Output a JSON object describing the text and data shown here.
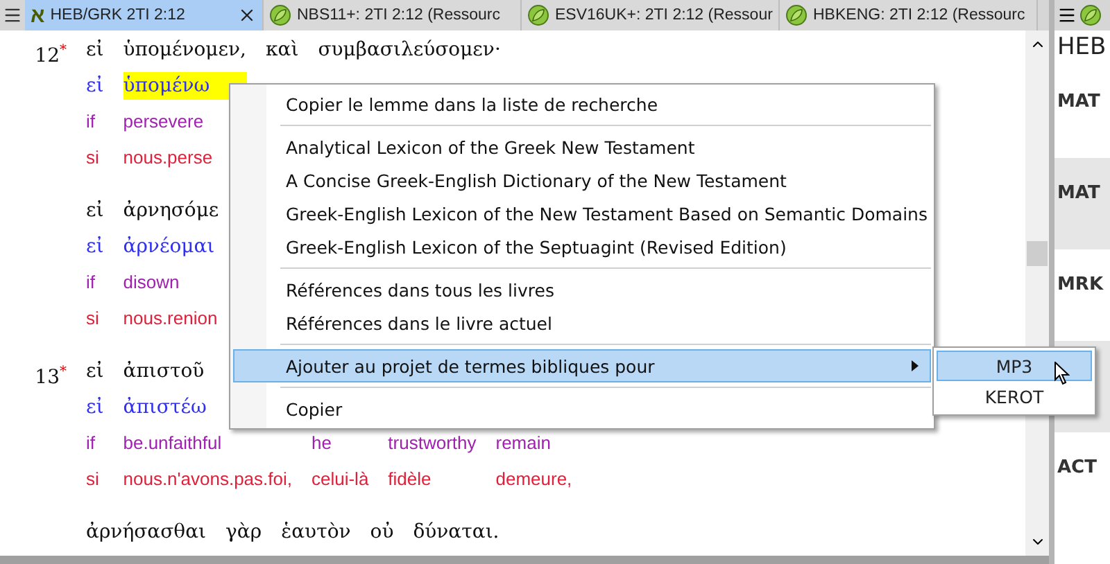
{
  "tabs": [
    {
      "label": "HEB/GRK 2TI 2:12",
      "glyph": "א",
      "selected": true
    },
    {
      "label": "NBS11+: 2TI 2:12 (Ressourc",
      "selected": false
    },
    {
      "label": "ESV16UK+: 2TI 2:12 (Ressour",
      "selected": false
    },
    {
      "label": "HBKENG: 2TI 2:12 (Ressourc",
      "selected": false
    }
  ],
  "text_blocks": [
    {
      "verse": {
        "number": "12",
        "mark": "*"
      },
      "lines": [
        {
          "kind": "greek",
          "words": [
            {
              "text": "εἰ"
            },
            {
              "text": "ὑπομένομεν,"
            },
            {
              "text": "καὶ"
            },
            {
              "text": "συμβασιλεύσομεν·"
            }
          ]
        },
        {
          "kind": "lemma",
          "words": [
            {
              "text": "εἰ",
              "highlighted": false
            },
            {
              "text": "ὑπομένω",
              "highlighted": true
            }
          ]
        },
        {
          "kind": "gloss_en",
          "words": [
            {
              "text": "if"
            },
            {
              "text": "persevere"
            }
          ]
        },
        {
          "kind": "gloss_fr",
          "words": [
            {
              "text": "si"
            },
            {
              "text": "nous.perse"
            }
          ]
        }
      ]
    },
    {
      "lines": [
        {
          "kind": "greek",
          "words": [
            {
              "text": "εἰ"
            },
            {
              "text": "ἀρνησόμε"
            }
          ]
        },
        {
          "kind": "lemma",
          "words": [
            {
              "text": "εἰ"
            },
            {
              "text": "ἀρνέομαι"
            }
          ]
        },
        {
          "kind": "gloss_en",
          "words": [
            {
              "text": "if"
            },
            {
              "text": "disown"
            }
          ]
        },
        {
          "kind": "gloss_fr",
          "words": [
            {
              "text": "si"
            },
            {
              "text": "nous.renion"
            }
          ]
        }
      ]
    },
    {
      "verse": {
        "number": "13",
        "mark": "*"
      },
      "lines": [
        {
          "kind": "greek",
          "words": [
            {
              "text": "εἰ"
            },
            {
              "text": "ἀπιστοῦ"
            }
          ]
        },
        {
          "kind": "lemma",
          "words": [
            {
              "text": "εἰ"
            },
            {
              "text": "ἀπιστέω"
            }
          ]
        },
        {
          "kind": "gloss_en",
          "words": [
            {
              "text": "if"
            },
            {
              "text": "be.unfaithful"
            },
            {
              "text": "he"
            },
            {
              "text": "trustworthy"
            },
            {
              "text": "remain"
            }
          ]
        },
        {
          "kind": "gloss_fr",
          "words": [
            {
              "text": "si"
            },
            {
              "text": "nous.n'avons.pas.foi,"
            },
            {
              "text": "celui-là"
            },
            {
              "text": "fidèle"
            },
            {
              "text": "demeure,"
            }
          ]
        }
      ]
    },
    {
      "lines": [
        {
          "kind": "greek",
          "words": [
            {
              "text": "ἀρνήσασθαι"
            },
            {
              "text": "γὰρ"
            },
            {
              "text": "ἑαυτὸν"
            },
            {
              "text": "οὐ"
            },
            {
              "text": "δύναται."
            }
          ]
        }
      ]
    }
  ],
  "context_menu": [
    {
      "kind": "item",
      "label": "Copier le lemme dans la liste de recherche",
      "highlighted": false
    },
    {
      "kind": "separator"
    },
    {
      "kind": "item",
      "label": "Analytical Lexicon of the Greek New Testament",
      "highlighted": false
    },
    {
      "kind": "item",
      "label": "A Concise Greek-English Dictionary of the New Testament",
      "highlighted": false
    },
    {
      "kind": "item",
      "label": "Greek-English Lexicon of the New Testament Based on Semantic Domains",
      "highlighted": false
    },
    {
      "kind": "item",
      "label": "Greek-English Lexicon of the Septuagint (Revised Edition)",
      "highlighted": false
    },
    {
      "kind": "separator"
    },
    {
      "kind": "item",
      "label": "Références dans tous les livres",
      "highlighted": false
    },
    {
      "kind": "item",
      "label": "Références dans le livre actuel",
      "highlighted": false
    },
    {
      "kind": "separator"
    },
    {
      "kind": "submenu",
      "label": "Ajouter au projet de termes bibliques pour",
      "highlighted": true
    },
    {
      "kind": "separator"
    },
    {
      "kind": "item",
      "label": "Copier",
      "highlighted": false
    }
  ],
  "submenu": [
    {
      "label": "MP3",
      "selected": true
    },
    {
      "label": "KEROT",
      "selected": false
    }
  ],
  "side_pane": {
    "header": "HEB",
    "books": [
      {
        "kind": "book",
        "label": "MAT"
      },
      {
        "kind": "book",
        "label": "MAT"
      },
      {
        "kind": "book",
        "label": "MRK"
      },
      {
        "kind": "covered"
      },
      {
        "kind": "book",
        "label": "ACT"
      }
    ]
  }
}
